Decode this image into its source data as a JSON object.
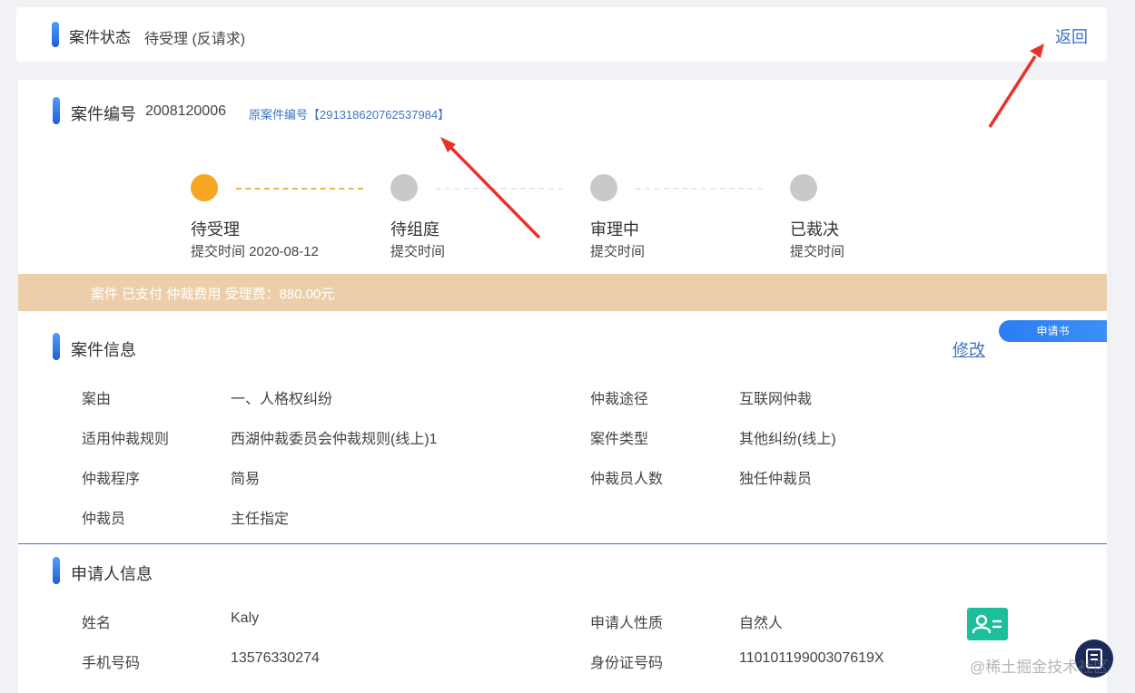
{
  "status_card": {
    "title": "案件状态",
    "value": "待受理 (反请求)",
    "back_label": "返回"
  },
  "case_header": {
    "title": "案件编号",
    "number": "2008120006",
    "original_link": "原案件编号【291318620762537984】"
  },
  "steps": [
    {
      "label": "待受理",
      "time": "提交时间 2020-08-12",
      "active": true
    },
    {
      "label": "待组庭",
      "time": "提交时间",
      "active": false
    },
    {
      "label": "审理中",
      "time": "提交时间",
      "active": false
    },
    {
      "label": "已裁决",
      "time": "提交时间",
      "active": false
    }
  ],
  "payment_banner": "案件 已支付 仲裁费用 受理费：880.00元",
  "application_tag": "申请书",
  "case_info": {
    "title": "案件信息",
    "edit_label": "修改",
    "fields": [
      {
        "label": "案由",
        "value": "一、人格权纠纷"
      },
      {
        "label": "仲裁途径",
        "value": "互联网仲裁"
      },
      {
        "label": "适用仲裁规则",
        "value": "西湖仲裁委员会仲裁规则(线上)1"
      },
      {
        "label": "案件类型",
        "value": "其他纠纷(线上)"
      },
      {
        "label": "仲裁程序",
        "value": "简易"
      },
      {
        "label": "仲裁员人数",
        "value": "独任仲裁员"
      },
      {
        "label": "仲裁员",
        "value": "主任指定"
      }
    ]
  },
  "applicant_info": {
    "title": "申请人信息",
    "fields": [
      {
        "label": "姓名",
        "value": "Kaly"
      },
      {
        "label": "申请人性质",
        "value": "自然人"
      },
      {
        "label": "手机号码",
        "value": "13576330274"
      },
      {
        "label": "身份证号码",
        "value": "11010119900307619X"
      }
    ]
  },
  "watermark": "@稀土掘金技术社区",
  "colors": {
    "accent_blue": "#3e74c4",
    "step_active": "#f5a623",
    "step_inactive": "#c9c9c9",
    "banner_bg": "#eccfaa",
    "id_card_green": "#1bbf9a",
    "annotation_arrow": "#e8322a"
  }
}
